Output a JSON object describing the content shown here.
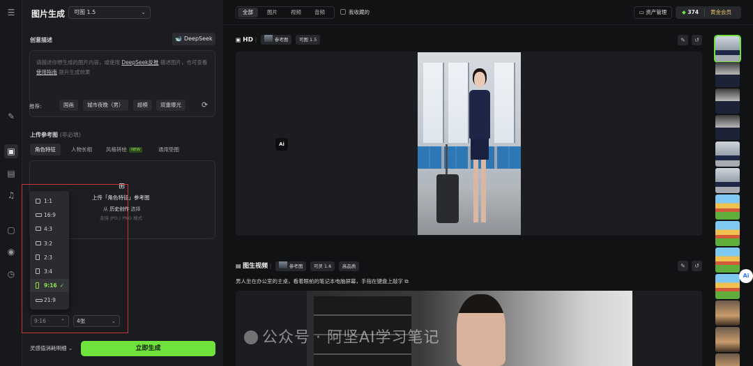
{
  "panel": {
    "title": "图片生成",
    "model": "可图 1.5",
    "creative_desc_label": "创意描述",
    "deepseek_label": "DeepSeek",
    "prompt_placeholder_1": "请描述你想生成的图片内容，或使用",
    "prompt_link_1": "DeepSeek反推",
    "prompt_placeholder_2": "描述图片，也可查看",
    "prompt_link_2": "使用指南",
    "prompt_placeholder_3": "提升生成效果",
    "recommend_label": "推荐:",
    "chips": [
      "国画",
      "城市夜晚（男）",
      "超模",
      "双重曝光"
    ],
    "ref_label": "上传参考图",
    "ref_hint": "(非必填)",
    "tabs": [
      "角色特征",
      "人物长相",
      "风格转绘",
      "通用垫图"
    ],
    "new_badge": "NEW",
    "upload_title": "上传「角色特征」参考图",
    "upload_from": "从",
    "upload_history": "历史创作",
    "upload_select": "选择",
    "upload_formats": "支持 JPG / PNG 格式",
    "ratios": [
      "1:1",
      "16:9",
      "4:3",
      "3:2",
      "2:3",
      "3:4",
      "9:16",
      "21:9"
    ],
    "selected_ratio": "9:16",
    "count": "4张",
    "cost_label": "灵感值消耗明细",
    "generate": "立即生成"
  },
  "topbar": {
    "filters": [
      "全部",
      "图片",
      "视频",
      "音频"
    ],
    "favorites": "我收藏的",
    "assets": "资产管理",
    "points": "374",
    "vip": "黄金会员"
  },
  "card1": {
    "title": "HD",
    "ref_tag": "参考图",
    "model_tag": "可图 1.5",
    "ai_badge": "Ai"
  },
  "card2": {
    "title": "图生视频",
    "ref_tag": "参考图",
    "model_tag": "可灵 1.6",
    "quality_tag": "高品质",
    "description": "男人坐在办公室的主桌，看着眼前的笔记本电脑屏幕，手指在键盘上敲字"
  },
  "watermark": "公众号 · 阿坚AI学习笔记",
  "ai_float": "Ai",
  "colors": {
    "accent": "#6fe23d",
    "vip_gold": "#e8c66a",
    "highlight_frame": "#c8383a"
  }
}
